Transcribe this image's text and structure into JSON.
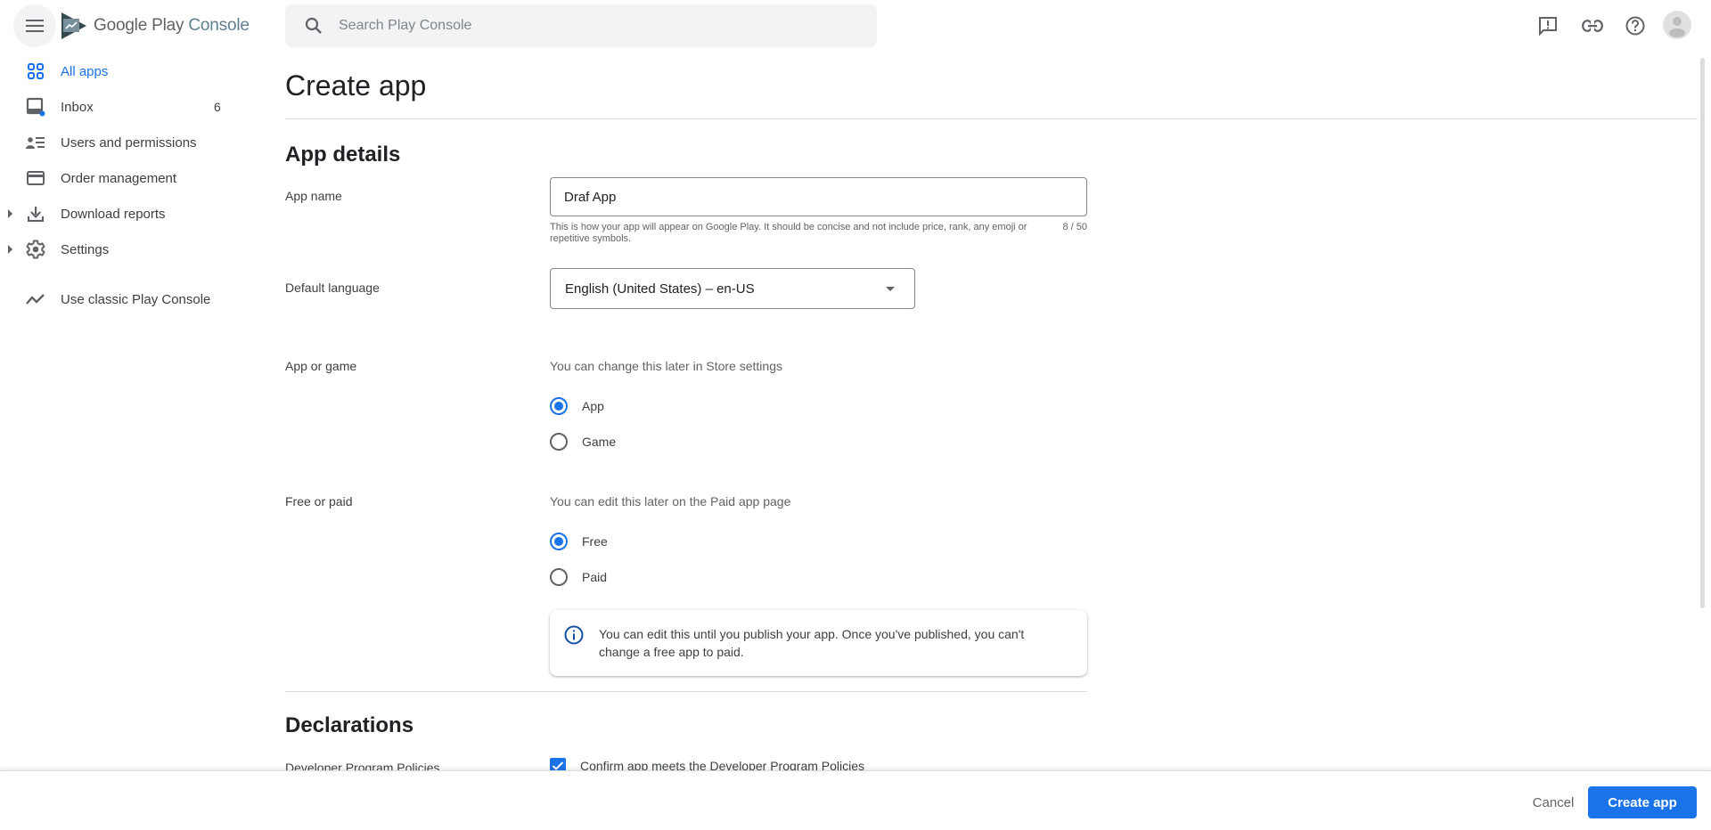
{
  "header": {
    "logo": {
      "brand": "Google Play",
      "product": "Console"
    },
    "search": {
      "placeholder": "Search Play Console",
      "value": ""
    },
    "icons": [
      "feedback-icon",
      "link-icon",
      "help-icon",
      "account-avatar"
    ]
  },
  "sidebar": {
    "items": [
      {
        "label": "All apps",
        "icon": "grid-icon",
        "active": true
      },
      {
        "label": "Inbox",
        "icon": "inbox-icon",
        "badge": "6",
        "has_notification_dot": true
      },
      {
        "label": "Users and permissions",
        "icon": "users-list-icon"
      },
      {
        "label": "Order management",
        "icon": "credit-card-icon"
      },
      {
        "label": "Download reports",
        "icon": "download-icon",
        "expandable": true
      },
      {
        "label": "Settings",
        "icon": "gear-icon",
        "expandable": true
      },
      {
        "label": "Use classic Play Console",
        "icon": "trending-icon"
      }
    ]
  },
  "main": {
    "title": "Create app",
    "app_details": {
      "heading": "App details",
      "app_name": {
        "label": "App name",
        "value": "Draf App",
        "helper": "This is how your app will appear on Google Play. It should be concise and not include price, rank, any emoji or repetitive symbols.",
        "counter": "8 / 50"
      },
      "default_language": {
        "label": "Default language",
        "value": "English (United States) – en-US"
      },
      "app_or_game": {
        "label": "App or game",
        "hint": "You can change this later in Store settings",
        "options": [
          {
            "label": "App",
            "checked": true
          },
          {
            "label": "Game",
            "checked": false
          }
        ]
      },
      "free_or_paid": {
        "label": "Free or paid",
        "hint": "You can edit this later on the Paid app page",
        "options": [
          {
            "label": "Free",
            "checked": true
          },
          {
            "label": "Paid",
            "checked": false
          }
        ],
        "info": "You can edit this until you publish your app. Once you've published, you can't change a free app to paid."
      }
    },
    "declarations": {
      "heading": "Declarations",
      "developer_program_policies": {
        "label": "Developer Program Policies",
        "checkbox_label": "Confirm app meets the Developer Program Policies",
        "checked": true
      }
    }
  },
  "footer": {
    "cancel_label": "Cancel",
    "create_label": "Create app"
  },
  "colors": {
    "accent": "#1a73e8",
    "text_primary": "#202124",
    "text_secondary": "#5f6368",
    "divider": "#dadce0"
  }
}
